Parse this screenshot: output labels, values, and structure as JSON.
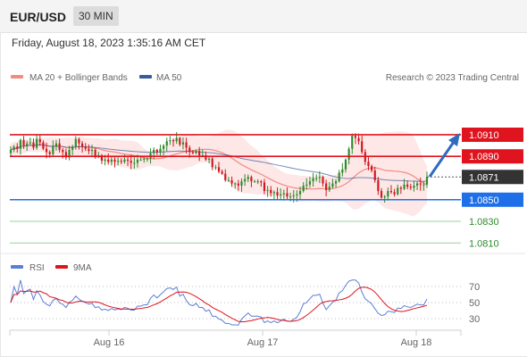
{
  "header": {
    "symbol": "EUR/USD",
    "timeframe": "30 MIN"
  },
  "datetime": "Friday, August 18, 2023 1:35:16 AM CET",
  "legend": {
    "ma20_label": "MA 20 + Bollinger Bands",
    "ma50_label": "MA 50",
    "source": "Research © 2023 Trading Central"
  },
  "rsi_legend": {
    "rsi_label": "RSI",
    "ma_label": "9MA"
  },
  "colors": {
    "ma20": "#f28b82",
    "ma50": "#3a5a9c",
    "band": "#fde3e3",
    "resistance": "#e0141e",
    "support": "#1e6fe8",
    "target": "#2e8b2e",
    "current": "#333333",
    "arrow": "#2f6bbf",
    "rsi": "#5a7fd6",
    "rsi_ma": "#e0141e",
    "candle_up": "#2e8b2e",
    "candle_down": "#d0181f"
  },
  "levels": [
    {
      "value": "1.0910",
      "kind": "resistance"
    },
    {
      "value": "1.0890",
      "kind": "resistance"
    },
    {
      "value": "1.0871",
      "kind": "current"
    },
    {
      "value": "1.0850",
      "kind": "support"
    },
    {
      "value": "1.0830",
      "kind": "target"
    },
    {
      "value": "1.0810",
      "kind": "target"
    }
  ],
  "rsi_ticks": [
    "70",
    "50",
    "30"
  ],
  "x_ticks": [
    "Aug 16",
    "Aug 17",
    "Aug 18"
  ],
  "chart_data": [
    {
      "type": "candlestick",
      "ylim": [
        1.0802,
        1.0952
      ],
      "overlays": [
        "MA 20 + Bollinger Bands",
        "MA 50"
      ],
      "current_price": 1.0871,
      "horizontal_levels": [
        1.091,
        1.089,
        1.085,
        1.083,
        1.081
      ],
      "close": [
        1.0896,
        1.0899,
        1.0897,
        1.0905,
        1.09,
        1.0902,
        1.0903,
        1.0898,
        1.0906,
        1.0903,
        1.0897,
        1.0894,
        1.0892,
        1.0899,
        1.0902,
        1.0896,
        1.0894,
        1.0889,
        1.0896,
        1.0899,
        1.0906,
        1.0902,
        1.0899,
        1.0897,
        1.0895,
        1.0896,
        1.089,
        1.0891,
        1.0886,
        1.0887,
        1.0885,
        1.0887,
        1.0885,
        1.0886,
        1.0885,
        1.0887,
        1.0886,
        1.0884,
        1.0884,
        1.0887,
        1.0887,
        1.0888,
        1.0888,
        1.0893,
        1.0896,
        1.0894,
        1.0897,
        1.09,
        1.0904,
        1.0905,
        1.0904,
        1.0907,
        1.0901,
        1.0903,
        1.0898,
        1.0894,
        1.0893,
        1.0895,
        1.0891,
        1.0891,
        1.0887,
        1.0888,
        1.088,
        1.088,
        1.0876,
        1.0874,
        1.0868,
        1.0868,
        1.0865,
        1.0865,
        1.0863,
        1.0867,
        1.0869,
        1.0871,
        1.0867,
        1.0867,
        1.0867,
        1.0866,
        1.0858,
        1.0859,
        1.0856,
        1.0857,
        1.0854,
        1.0855,
        1.0856,
        1.0853,
        1.0853,
        1.0854,
        1.0855,
        1.0858,
        1.0863,
        1.0864,
        1.0867,
        1.087,
        1.087,
        1.0871,
        1.0865,
        1.0859,
        1.0862,
        1.0865,
        1.0867,
        1.0875,
        1.0878,
        1.0887,
        1.0897,
        1.0909,
        1.0907,
        1.0904,
        1.0894,
        1.0885,
        1.0881,
        1.0877,
        1.0868,
        1.0858,
        1.0852,
        1.0853,
        1.0858,
        1.0857,
        1.0855,
        1.0861,
        1.086,
        1.0864,
        1.0862,
        1.0861,
        1.0863,
        1.0865,
        1.0864,
        1.0864,
        1.0871
      ]
    },
    {
      "type": "line",
      "title": "RSI",
      "series": [
        {
          "name": "RSI"
        },
        {
          "name": "9MA"
        }
      ],
      "ylim": [
        20,
        80
      ],
      "yticks": [
        70,
        50,
        30
      ]
    }
  ]
}
